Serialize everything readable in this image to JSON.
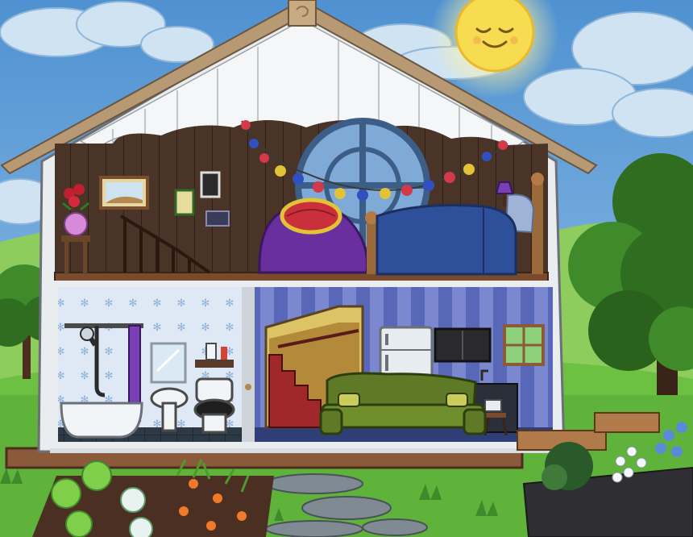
{
  "scene": {
    "colors": {
      "sky_top": "#4f91d1",
      "sky_bottom": "#9cc8ea",
      "grass": "#5fb33a",
      "grass_dark": "#3f8a2a",
      "house_white": "#e9edf0",
      "roof_trim": "#b79a73",
      "attic_wall": "#4a3327",
      "attic_floor": "#7a4a2c",
      "bathroom_wall": "#dfe8f5",
      "living_wall_a": "#5867b8",
      "living_wall_b": "#7b88cf",
      "sofa": "#5e7a26",
      "bed_blanket": "#2e4f9a",
      "beanbag": "#6a2f9e",
      "sun": "#f7dc52",
      "path_stone": "#7f8a92",
      "soil": "#4a2f22"
    },
    "icons": [
      "sun-face-icon",
      "cloud-icon",
      "house-icon",
      "roof-icon",
      "string-lights-icon",
      "bed-icon",
      "beanbag-icon",
      "picture-frame-icon",
      "flower-vase-icon",
      "staircase-icon",
      "shower-icon",
      "bathtub-icon",
      "sink-icon",
      "toilet-icon",
      "mirror-icon",
      "sofa-icon",
      "refrigerator-icon",
      "microwave-icon",
      "window-icon",
      "lamp-icon",
      "tree-icon",
      "vegetable-garden-icon",
      "flower-planter-icon",
      "stepping-stone-icon"
    ]
  }
}
